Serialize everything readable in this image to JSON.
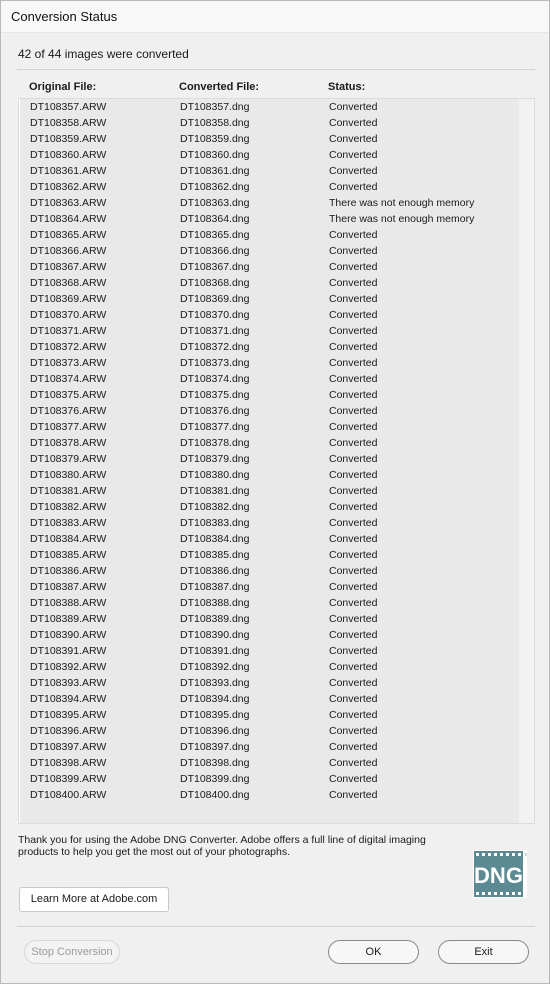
{
  "window": {
    "title": "Conversion Status"
  },
  "summary": "42 of 44 images were converted",
  "table": {
    "headers": [
      "Original File:",
      "Converted File:",
      "Status:"
    ],
    "rows": [
      [
        "DT108357.ARW",
        "DT108357.dng",
        "Converted"
      ],
      [
        "DT108358.ARW",
        "DT108358.dng",
        "Converted"
      ],
      [
        "DT108359.ARW",
        "DT108359.dng",
        "Converted"
      ],
      [
        "DT108360.ARW",
        "DT108360.dng",
        "Converted"
      ],
      [
        "DT108361.ARW",
        "DT108361.dng",
        "Converted"
      ],
      [
        "DT108362.ARW",
        "DT108362.dng",
        "Converted"
      ],
      [
        "DT108363.ARW",
        "DT108363.dng",
        "There was not enough memory"
      ],
      [
        "DT108364.ARW",
        "DT108364.dng",
        "There was not enough memory"
      ],
      [
        "DT108365.ARW",
        "DT108365.dng",
        "Converted"
      ],
      [
        "DT108366.ARW",
        "DT108366.dng",
        "Converted"
      ],
      [
        "DT108367.ARW",
        "DT108367.dng",
        "Converted"
      ],
      [
        "DT108368.ARW",
        "DT108368.dng",
        "Converted"
      ],
      [
        "DT108369.ARW",
        "DT108369.dng",
        "Converted"
      ],
      [
        "DT108370.ARW",
        "DT108370.dng",
        "Converted"
      ],
      [
        "DT108371.ARW",
        "DT108371.dng",
        "Converted"
      ],
      [
        "DT108372.ARW",
        "DT108372.dng",
        "Converted"
      ],
      [
        "DT108373.ARW",
        "DT108373.dng",
        "Converted"
      ],
      [
        "DT108374.ARW",
        "DT108374.dng",
        "Converted"
      ],
      [
        "DT108375.ARW",
        "DT108375.dng",
        "Converted"
      ],
      [
        "DT108376.ARW",
        "DT108376.dng",
        "Converted"
      ],
      [
        "DT108377.ARW",
        "DT108377.dng",
        "Converted"
      ],
      [
        "DT108378.ARW",
        "DT108378.dng",
        "Converted"
      ],
      [
        "DT108379.ARW",
        "DT108379.dng",
        "Converted"
      ],
      [
        "DT108380.ARW",
        "DT108380.dng",
        "Converted"
      ],
      [
        "DT108381.ARW",
        "DT108381.dng",
        "Converted"
      ],
      [
        "DT108382.ARW",
        "DT108382.dng",
        "Converted"
      ],
      [
        "DT108383.ARW",
        "DT108383.dng",
        "Converted"
      ],
      [
        "DT108384.ARW",
        "DT108384.dng",
        "Converted"
      ],
      [
        "DT108385.ARW",
        "DT108385.dng",
        "Converted"
      ],
      [
        "DT108386.ARW",
        "DT108386.dng",
        "Converted"
      ],
      [
        "DT108387.ARW",
        "DT108387.dng",
        "Converted"
      ],
      [
        "DT108388.ARW",
        "DT108388.dng",
        "Converted"
      ],
      [
        "DT108389.ARW",
        "DT108389.dng",
        "Converted"
      ],
      [
        "DT108390.ARW",
        "DT108390.dng",
        "Converted"
      ],
      [
        "DT108391.ARW",
        "DT108391.dng",
        "Converted"
      ],
      [
        "DT108392.ARW",
        "DT108392.dng",
        "Converted"
      ],
      [
        "DT108393.ARW",
        "DT108393.dng",
        "Converted"
      ],
      [
        "DT108394.ARW",
        "DT108394.dng",
        "Converted"
      ],
      [
        "DT108395.ARW",
        "DT108395.dng",
        "Converted"
      ],
      [
        "DT108396.ARW",
        "DT108396.dng",
        "Converted"
      ],
      [
        "DT108397.ARW",
        "DT108397.dng",
        "Converted"
      ],
      [
        "DT108398.ARW",
        "DT108398.dng",
        "Converted"
      ],
      [
        "DT108399.ARW",
        "DT108399.dng",
        "Converted"
      ],
      [
        "DT108400.ARW",
        "DT108400.dng",
        "Converted"
      ]
    ]
  },
  "thanks": {
    "line1": "Thank you for using the Adobe DNG Converter.  Adobe offers a full line of digital imaging",
    "line2": "products to help you get the most out of your photographs."
  },
  "logo": {
    "text": "DNG",
    "mark": "TM",
    "color": "#5b8a92"
  },
  "buttons": {
    "learn_more": "Learn More at Adobe.com",
    "stop": "Stop Conversion",
    "ok": "OK",
    "exit": "Exit"
  }
}
